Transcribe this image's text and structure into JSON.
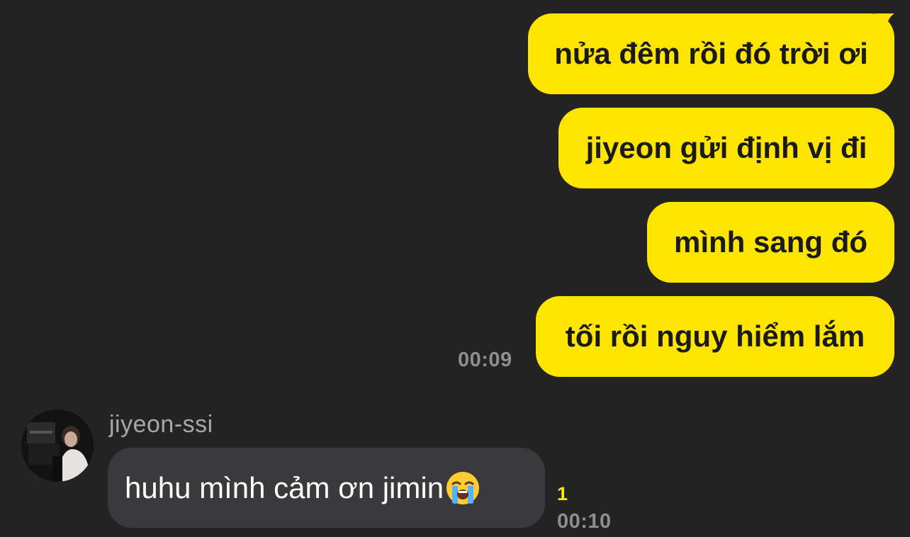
{
  "colors": {
    "background": "#232323",
    "outgoing_bubble": "#fee500",
    "incoming_bubble": "#3a3a3c",
    "unread_count": "#fee500",
    "timestamp": "#8e8e8e"
  },
  "messages_out": [
    {
      "text": "nửa đêm rồi đó trời ơi"
    },
    {
      "text": "jiyeon gửi định vị đi"
    },
    {
      "text": "mình sang đó"
    },
    {
      "text": "tối rồi nguy hiểm lắm"
    }
  ],
  "messages_out_time": "00:09",
  "incoming": {
    "sender": "jiyeon-ssi",
    "avatar_icon": "profile-photo",
    "text": "huhu mình cảm ơn jimin",
    "emoji_icon": "loudly-crying-face-icon",
    "unread_count": "1",
    "time": "00:10"
  }
}
